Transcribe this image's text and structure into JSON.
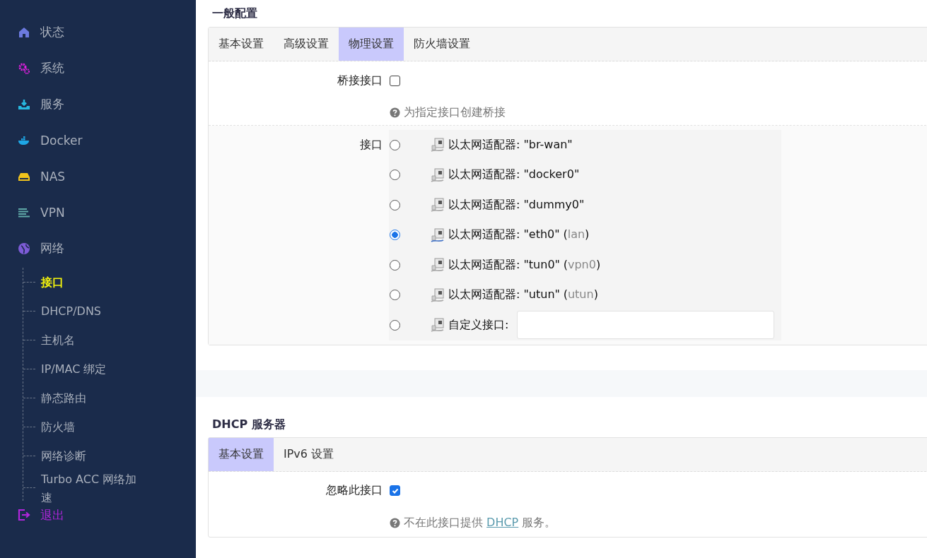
{
  "sidebar": {
    "menu": [
      {
        "label": "状态"
      },
      {
        "label": "系统"
      },
      {
        "label": "服务"
      },
      {
        "label": "Docker"
      },
      {
        "label": "NAS"
      },
      {
        "label": "VPN"
      },
      {
        "label": "网络"
      }
    ],
    "submenu": [
      {
        "label": "接口",
        "selected": true
      },
      {
        "label": "DHCP/DNS",
        "selected": false
      },
      {
        "label": "主机名",
        "selected": false
      },
      {
        "label": "IP/MAC 绑定",
        "selected": false
      },
      {
        "label": "静态路由",
        "selected": false
      },
      {
        "label": "防火墙",
        "selected": false
      },
      {
        "label": "网络诊断",
        "selected": false
      },
      {
        "label": "Turbo ACC 网络加速",
        "selected": false
      }
    ],
    "logout": {
      "label": "退出"
    }
  },
  "general": {
    "title": "一般配置",
    "tabs": [
      {
        "label": "基本设置",
        "selected": false
      },
      {
        "label": "高级设置",
        "selected": false
      },
      {
        "label": "物理设置",
        "selected": true
      },
      {
        "label": "防火墙设置",
        "selected": false
      }
    ],
    "bridge": {
      "label": "桥接接口",
      "checked": false,
      "help": "为指定接口创建桥接"
    },
    "interface": {
      "label": "接口",
      "options": [
        {
          "kind": "adapter",
          "name": "以太网适配器: \"br-wan\"",
          "selected": false
        },
        {
          "kind": "adapter",
          "name": "以太网适配器: \"docker0\"",
          "selected": false
        },
        {
          "kind": "adapter",
          "name": "以太网适配器: \"dummy0\"",
          "selected": false
        },
        {
          "kind": "adapter",
          "name": "以太网适配器: \"eth0\"",
          "alias_open": "(",
          "alias": "lan",
          "alias_close": ")",
          "selected": true
        },
        {
          "kind": "adapter",
          "name": "以太网适配器: \"tun0\"",
          "alias_open": "(",
          "alias": "vpn0",
          "alias_close": ")",
          "selected": false
        },
        {
          "kind": "adapter",
          "name": "以太网适配器: \"utun\"",
          "alias_open": "(",
          "alias": "utun",
          "alias_close": ")",
          "selected": false
        },
        {
          "kind": "custom",
          "name": "自定义接口:",
          "selected": false
        }
      ]
    }
  },
  "dhcp": {
    "title": "DHCP 服务器",
    "tabs": [
      {
        "label": "基本设置",
        "selected": true
      },
      {
        "label": "IPv6 设置",
        "selected": false
      }
    ],
    "ignore": {
      "label": "忽略此接口",
      "checked": true,
      "help_before": "不在此接口提供",
      "help_link": "DHCP",
      "help_after": "服务。"
    }
  }
}
